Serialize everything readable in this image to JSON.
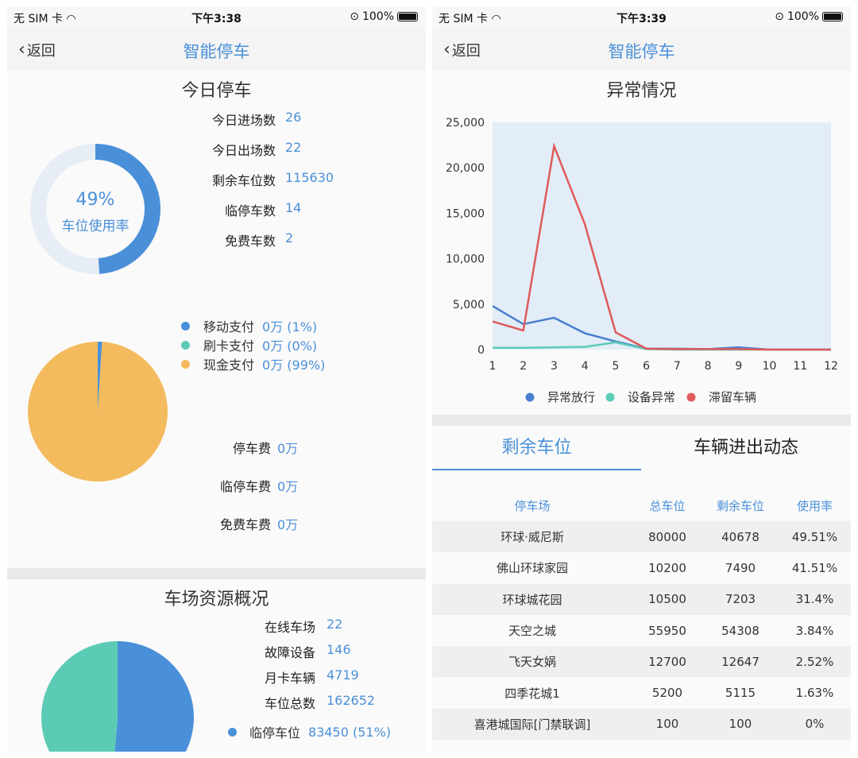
{
  "left_screen": {
    "status": {
      "carrier": "无 SIM 卡",
      "time": "下午3:38",
      "battery": "100%"
    },
    "nav": {
      "back": "返回",
      "title": "智能停车"
    },
    "today": {
      "title": "今日停车",
      "usage_pct": "49%",
      "usage_label": "车位使用率",
      "usage_fraction": 0.49,
      "stats": [
        {
          "label": "今日进场数",
          "value": "26"
        },
        {
          "label": "今日出场数",
          "value": "22"
        },
        {
          "label": "剩余车位数",
          "value": "115630"
        },
        {
          "label": "临停车数",
          "value": "14"
        },
        {
          "label": "免费车数",
          "value": "2"
        }
      ],
      "payment_legend": [
        {
          "label": "移动支付",
          "value": "0万 (1%)",
          "color": "#4a90d9"
        },
        {
          "label": "刷卡支付",
          "value": "0万 (0%)",
          "color": "#5ccbb6"
        },
        {
          "label": "现金支付",
          "value": "0万 (99%)",
          "color": "#f3bb5d"
        }
      ],
      "fees": [
        {
          "label": "停车费",
          "value": "0万"
        },
        {
          "label": "临停车费",
          "value": "0万"
        },
        {
          "label": "免费车费",
          "value": "0万"
        }
      ]
    },
    "resources": {
      "title": "车场资源概况",
      "stats": [
        {
          "label": "在线车场",
          "value": "22"
        },
        {
          "label": "故障设备",
          "value": "146"
        },
        {
          "label": "月卡车辆",
          "value": "4719"
        },
        {
          "label": "车位总数",
          "value": "162652"
        }
      ],
      "legend": [
        {
          "label": "临停车位",
          "value": "83450 (51%)",
          "color": "#4a90d9"
        }
      ]
    }
  },
  "right_screen": {
    "status": {
      "carrier": "无 SIM 卡",
      "time": "下午3:39",
      "battery": "100%"
    },
    "nav": {
      "back": "返回",
      "title": "智能停车"
    },
    "chart_title": "异常情况",
    "tabs": [
      {
        "label": "剩余车位",
        "active": true
      },
      {
        "label": "车辆进出动态",
        "active": false
      }
    ],
    "table": {
      "headers": [
        "停车场",
        "总车位",
        "剩余车位",
        "使用率"
      ],
      "rows": [
        [
          "环球·威尼斯",
          "80000",
          "40678",
          "49.51%"
        ],
        [
          "佛山环球家园",
          "10200",
          "7490",
          "41.51%"
        ],
        [
          "环球城花园",
          "10500",
          "7203",
          "31.4%"
        ],
        [
          "天空之城",
          "55950",
          "54308",
          "3.84%"
        ],
        [
          "飞天女娲",
          "12700",
          "12647",
          "2.52%"
        ],
        [
          "四季花城1",
          "5200",
          "5115",
          "1.63%"
        ],
        [
          "喜港城国际[门禁联调]",
          "100",
          "100",
          "0%"
        ]
      ]
    }
  },
  "chart_data": [
    {
      "type": "pie",
      "slices": [
        {
          "name": "移动支付",
          "value": 1,
          "color": "#4a90d9"
        },
        {
          "name": "刷卡支付",
          "value": 0,
          "color": "#5ccbb6"
        },
        {
          "name": "现金支付",
          "value": 99,
          "color": "#f3bb5d"
        }
      ]
    },
    {
      "type": "pie",
      "slices": [
        {
          "name": "临停车位",
          "value": 83450,
          "color": "#4a90d9"
        },
        {
          "name": "",
          "value": 79202,
          "color": "#5ccbb6"
        }
      ]
    },
    {
      "type": "line",
      "title": "异常情况",
      "x": [
        1,
        2,
        3,
        4,
        5,
        6,
        7,
        8,
        9,
        10,
        11,
        12
      ],
      "ylim": [
        0,
        25000
      ],
      "yticks": [
        "0",
        "5,000",
        "10,000",
        "15,000",
        "20,000",
        "25,000"
      ],
      "series": [
        {
          "name": "异常放行",
          "color": "#4a7fcf",
          "values": [
            4800,
            2800,
            3500,
            1800,
            900,
            100,
            100,
            50,
            250,
            0,
            0,
            0
          ]
        },
        {
          "name": "设备异常",
          "color": "#5ccbb6",
          "values": [
            200,
            200,
            250,
            300,
            800,
            50,
            0,
            0,
            0,
            0,
            0,
            0
          ]
        },
        {
          "name": "滞留车辆",
          "color": "#e05a5a",
          "values": [
            3100,
            2100,
            22400,
            13800,
            1900,
            100,
            50,
            50,
            50,
            0,
            0,
            0
          ]
        }
      ],
      "legend_position": "bottom",
      "plot_background": "#e2edf7"
    }
  ]
}
